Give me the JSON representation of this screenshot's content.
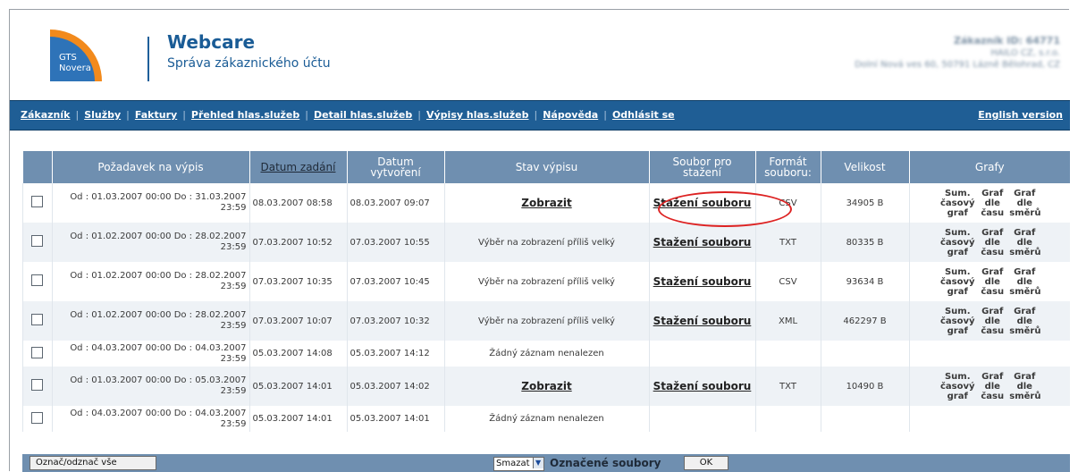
{
  "header": {
    "logo_line1": "GTS",
    "logo_line2": "Novera",
    "title": "Webcare",
    "subtitle": "Správa zákaznického účtu",
    "customer_id": "Zákazník ID: 64771",
    "customer_name": "HAILO CZ, s.r.o.",
    "customer_address": "Dolní Nová ves 60, 50791 Lázně Bělohrad, CZ"
  },
  "nav": {
    "items": [
      "Zákazník",
      "Služby",
      "Faktury",
      "Přehled hlas.služeb",
      "Detail hlas.služeb",
      "Výpisy hlas.služeb",
      "Nápověda",
      "Odhlásit se"
    ],
    "english": "English version"
  },
  "table": {
    "columns": [
      "",
      "Požadavek na výpis",
      "Datum zadání",
      "Datum vytvoření",
      "Stav výpisu",
      "Soubor pro stažení",
      "Formát souboru:",
      "Velikost",
      "Grafy"
    ],
    "graf_labels": [
      "Sum. časový graf",
      "Graf dle času",
      "Graf dle směrů"
    ],
    "rows": [
      {
        "req1": "Od : 01.03.2007 00:00 Do : 31.03.2007",
        "req2": "23:59",
        "zadani": "08.03.2007 08:58",
        "vytvoreni": "08.03.2007 09:07",
        "stav": "Zobrazit",
        "soubor": "Stažení souboru",
        "format": "CSV",
        "velikost": "34905 B",
        "grafy": true
      },
      {
        "req1": "Od : 01.02.2007 00:00 Do : 28.02.2007",
        "req2": "23:59",
        "zadani": "07.03.2007 10:52",
        "vytvoreni": "07.03.2007 10:55",
        "stav": "Výběr na zobrazení příliš velký",
        "soubor": "Stažení souboru",
        "format": "TXT",
        "velikost": "80335 B",
        "grafy": true
      },
      {
        "req1": "Od : 01.02.2007 00:00 Do : 28.02.2007",
        "req2": "23:59",
        "zadani": "07.03.2007 10:35",
        "vytvoreni": "07.03.2007 10:45",
        "stav": "Výběr na zobrazení příliš velký",
        "soubor": "Stažení souboru",
        "format": "CSV",
        "velikost": "93634 B",
        "grafy": true
      },
      {
        "req1": "Od : 01.02.2007 00:00 Do : 28.02.2007",
        "req2": "23:59",
        "zadani": "07.03.2007 10:07",
        "vytvoreni": "07.03.2007 10:32",
        "stav": "Výběr na zobrazení příliš velký",
        "soubor": "Stažení souboru",
        "format": "XML",
        "velikost": "462297 B",
        "grafy": true
      },
      {
        "req1": "Od : 04.03.2007 00:00 Do : 04.03.2007",
        "req2": "23:59",
        "zadani": "05.03.2007 14:08",
        "vytvoreni": "05.03.2007 14:12",
        "stav": "Žádný záznam nenalezen",
        "soubor": "",
        "format": "",
        "velikost": "",
        "grafy": false
      },
      {
        "req1": "Od : 01.03.2007 00:00 Do : 05.03.2007",
        "req2": "23:59",
        "zadani": "05.03.2007 14:01",
        "vytvoreni": "05.03.2007 14:02",
        "stav": "Zobrazit",
        "soubor": "Stažení souboru",
        "format": "TXT",
        "velikost": "10490 B",
        "grafy": true
      },
      {
        "req1": "Od : 04.03.2007 00:00 Do : 04.03.2007",
        "req2": "23:59",
        "zadani": "05.03.2007 14:01",
        "vytvoreni": "05.03.2007 14:01",
        "stav": "Žádný záznam nenalezen",
        "soubor": "",
        "format": "",
        "velikost": "",
        "grafy": false
      }
    ]
  },
  "footer": {
    "toggle_all": "Označ/odznač vše",
    "action_selected": "Smazat",
    "marked_label": "Označené soubory",
    "ok": "OK"
  },
  "colors": {
    "nav_bg": "#1f5e95",
    "header_row": "#6f8fb0",
    "title": "#1a5c96",
    "logo_orange": "#f28a1c",
    "logo_blue": "#2e73b8",
    "highlight_circle": "#dd2222"
  }
}
